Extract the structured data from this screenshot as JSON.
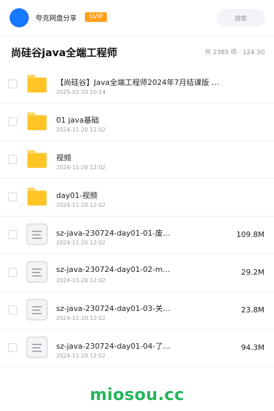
{
  "header": {
    "brand": "夸克网盘分享",
    "badge": "SVIP",
    "search_label": "搜索"
  },
  "page": {
    "title": "尚硅谷java全端工程师",
    "summary": "共 2385 项 · 124.3G"
  },
  "files": [
    {
      "type": "folder",
      "name": "【尚硅谷】Java全端工程师2024年7月结课版 …",
      "date": "2025-01-20 10:14",
      "size": ""
    },
    {
      "type": "folder",
      "name": "01 java基础",
      "date": "2024-11-20 12:02",
      "size": ""
    },
    {
      "type": "folder",
      "name": "视频",
      "date": "2024-11-20 12:02",
      "size": ""
    },
    {
      "type": "folder",
      "name": "day01-视频",
      "date": "2024-11-20 12:02",
      "size": ""
    },
    {
      "type": "file",
      "name": "sz-java-230724-day01-01-废…",
      "date": "2024-11-20 12:02",
      "size": "109.8M"
    },
    {
      "type": "file",
      "name": "sz-java-230724-day01-02-m…",
      "date": "2024-11-20 12:02",
      "size": "29.2M"
    },
    {
      "type": "file",
      "name": "sz-java-230724-day01-03-关…",
      "date": "2024-11-20 12:02",
      "size": "23.8M"
    },
    {
      "type": "file",
      "name": "sz-java-230724-day01-04-了…",
      "date": "2024-11-20 12:02",
      "size": "94.3M"
    }
  ],
  "footer": {
    "watermark": "miosou.cc"
  },
  "colors": {
    "avatar": "#1677ff",
    "svip_badge": "#ff9d18",
    "folder_icon": "#ffc524",
    "watermark": "#25b55a"
  }
}
